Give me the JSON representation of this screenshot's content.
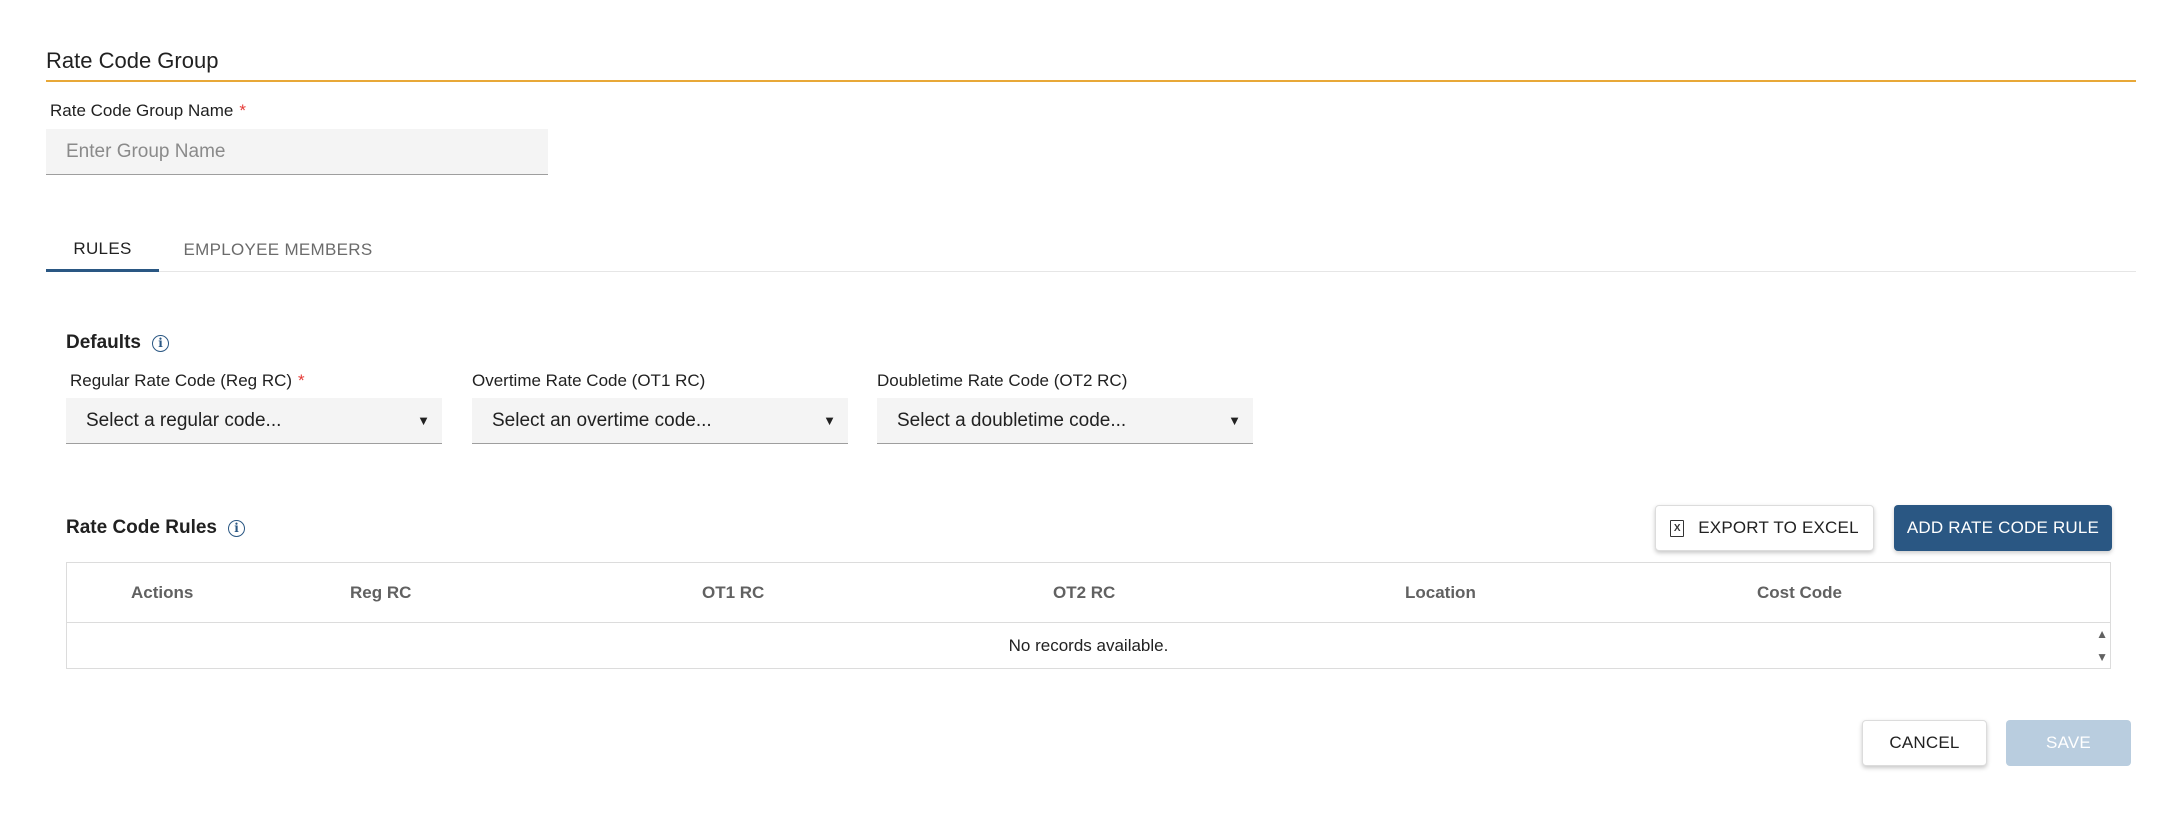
{
  "header": {
    "title": "Rate Code Group",
    "group_name_label": "Rate Code Group Name",
    "required_mark": "*",
    "group_name_placeholder": "Enter Group Name",
    "group_name_value": ""
  },
  "tabs": [
    {
      "label": "RULES",
      "active": true
    },
    {
      "label": "EMPLOYEE MEMBERS",
      "active": false
    }
  ],
  "defaults": {
    "title": "Defaults",
    "info_icon": "info-icon",
    "fields": [
      {
        "label": "Regular Rate Code (Reg RC)",
        "required": true,
        "placeholder": "Select a regular code..."
      },
      {
        "label": "Overtime Rate Code (OT1 RC)",
        "required": false,
        "placeholder": "Select an overtime code..."
      },
      {
        "label": "Doubletime Rate Code (OT2 RC)",
        "required": false,
        "placeholder": "Select a doubletime code..."
      }
    ]
  },
  "rules": {
    "title": "Rate Code Rules",
    "info_icon": "info-icon",
    "export_label": "EXPORT TO EXCEL",
    "export_icon": "excel-file-icon",
    "add_label": "ADD RATE CODE RULE",
    "columns": [
      "Actions",
      "Reg RC",
      "OT1 RC",
      "OT2 RC",
      "Location",
      "Cost Code"
    ],
    "rows": [],
    "empty_text": "No records available."
  },
  "footer": {
    "cancel_label": "CANCEL",
    "save_label": "SAVE",
    "save_disabled": true
  },
  "colors": {
    "accent_rule": "#e8a838",
    "primary": "#2a5783",
    "primary_disabled": "#b9cddf",
    "required": "#e53935"
  }
}
